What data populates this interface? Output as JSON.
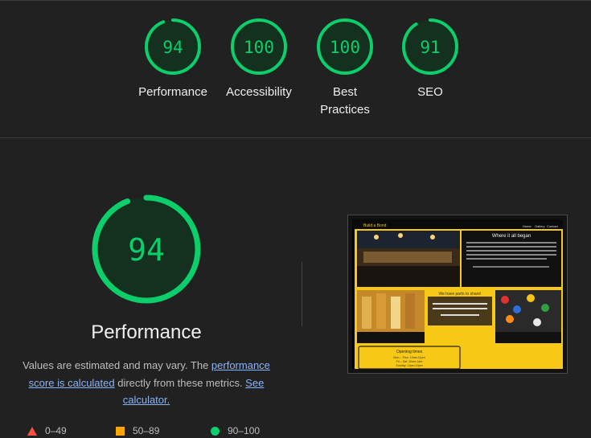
{
  "colors": {
    "pass": "#0cce6b",
    "average": "#ffa400",
    "fail": "#ff4e42",
    "accent_link": "#8ab4f8"
  },
  "summary": [
    {
      "score": "94",
      "value": 0.94,
      "label": "Performance"
    },
    {
      "score": "100",
      "value": 1.0,
      "label": "Accessibility"
    },
    {
      "score": "100",
      "value": 1.0,
      "label_line1": "Best",
      "label_line2": "Practices"
    },
    {
      "score": "91",
      "value": 0.91,
      "label": "SEO"
    }
  ],
  "performance": {
    "score": "94",
    "value": 0.94,
    "title": "Performance",
    "desc_prefix": "Values are estimated and may vary. The ",
    "desc_link1": "performance score is calculated",
    "desc_middle": " directly from these metrics. ",
    "desc_link2": "See calculator."
  },
  "legend": {
    "fail": "0–49",
    "average": "50–89",
    "pass": "90–100"
  },
  "screenshot": {
    "site_name": "Build a Bond",
    "nav_items": [
      "Home",
      "Gallery",
      "Contact"
    ],
    "hero_heading": "Where it all began",
    "box_heading": "We have parts to share!",
    "opening_heading": "Opening times",
    "opening_lines": [
      "Mon – Thur: 10am-11pm",
      "Fri – Sat: 10am-1am",
      "Sunday: 12pm-10pm"
    ]
  }
}
